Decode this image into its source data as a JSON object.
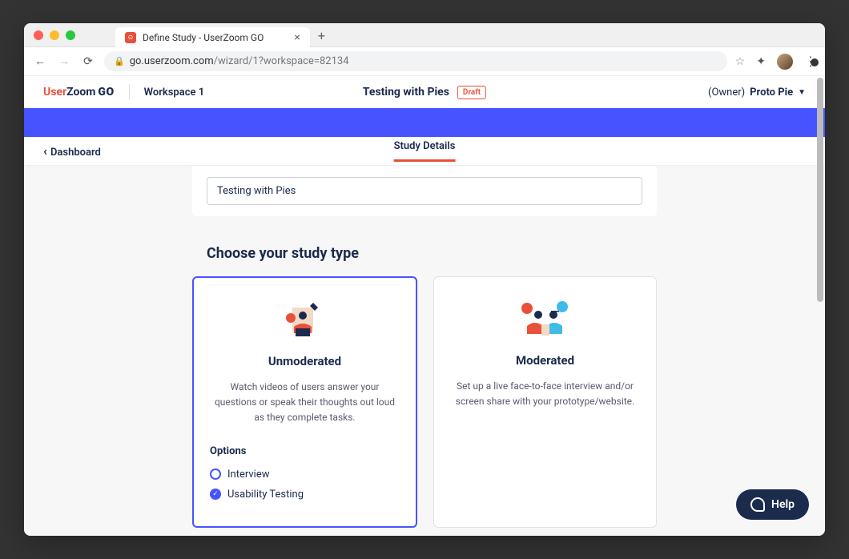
{
  "browser": {
    "tab_title": "Define Study - UserZoom GO",
    "url_domain": "go.userzoom.com",
    "url_path": "/wizard/1?workspace=82134"
  },
  "header": {
    "logo_user": "User",
    "logo_zoom": "Zoom",
    "logo_go": "GO",
    "workspace": "Workspace 1",
    "study_title": "Testing with Pies",
    "draft_badge": "Draft",
    "owner_label": "(Owner)",
    "owner_name": "Proto Pie"
  },
  "subnav": {
    "back_link": "Dashboard",
    "active_tab": "Study Details"
  },
  "form": {
    "study_name_value": "Testing with Pies",
    "section_title": "Choose your study type"
  },
  "cards": [
    {
      "title": "Unmoderated",
      "description": "Watch videos of users answer your questions or speak their thoughts out loud as they complete tasks.",
      "selected": true,
      "options_label": "Options",
      "options": [
        {
          "label": "Interview",
          "selected": false
        },
        {
          "label": "Usability Testing",
          "selected": true
        }
      ]
    },
    {
      "title": "Moderated",
      "description": "Set up a live face-to-face interview and/or screen share with your prototype/website.",
      "selected": false
    }
  ],
  "help": {
    "label": "Help"
  }
}
